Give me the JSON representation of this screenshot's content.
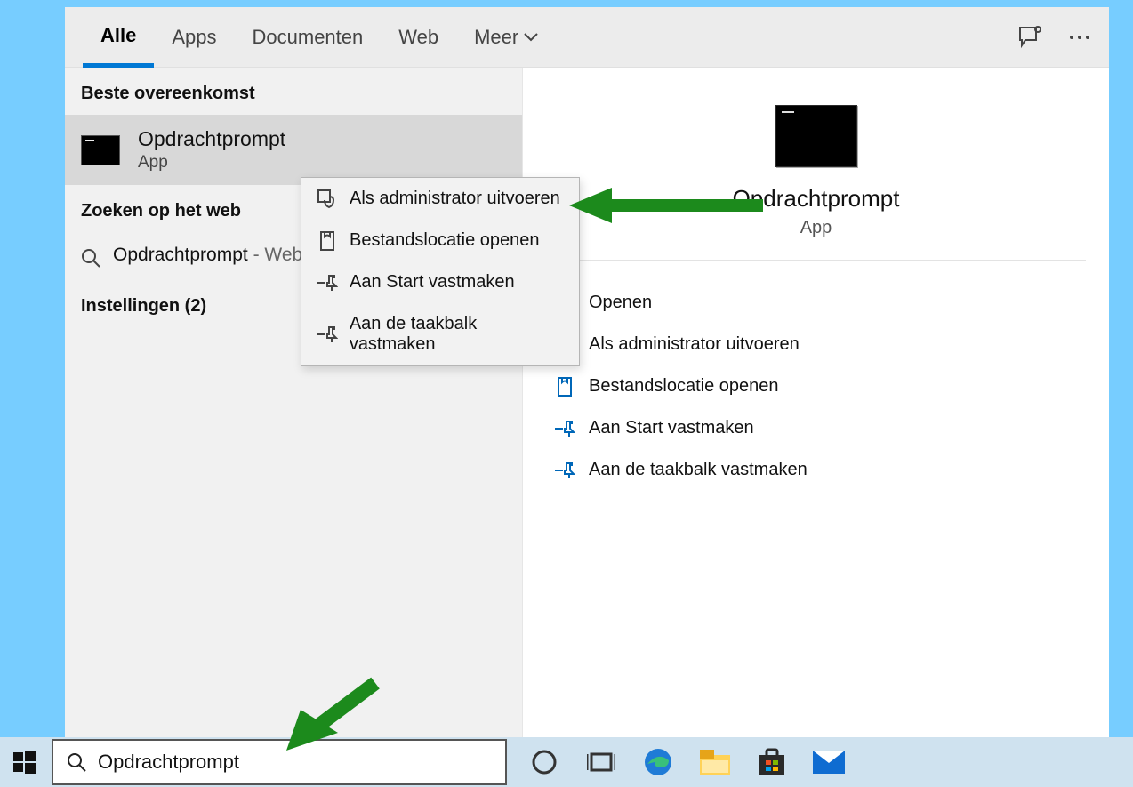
{
  "tabs": {
    "all": "Alle",
    "apps": "Apps",
    "docs": "Documenten",
    "web": "Web",
    "more": "Meer"
  },
  "left": {
    "best_header": "Beste overeenkomst",
    "best": {
      "title": "Opdrachtprompt",
      "sub": "App"
    },
    "web_header": "Zoeken op het web",
    "web_item": {
      "main": "Opdrachtprompt",
      "suffix": " - Webresultaten weergeven"
    },
    "settings_header": "Instellingen (2)"
  },
  "context_menu": {
    "run_as_admin": "Als administrator uitvoeren",
    "open_location": "Bestandslocatie openen",
    "pin_start": "Aan Start vastmaken",
    "pin_taskbar": "Aan de taakbalk vastmaken"
  },
  "right": {
    "title": "Opdrachtprompt",
    "sub": "App",
    "open": "Openen",
    "run_as_admin": "Als administrator uitvoeren",
    "open_location": "Bestandslocatie openen",
    "pin_start": "Aan Start vastmaken",
    "pin_taskbar": "Aan de taakbalk vastmaken"
  },
  "search": {
    "value": "Opdrachtprompt"
  }
}
